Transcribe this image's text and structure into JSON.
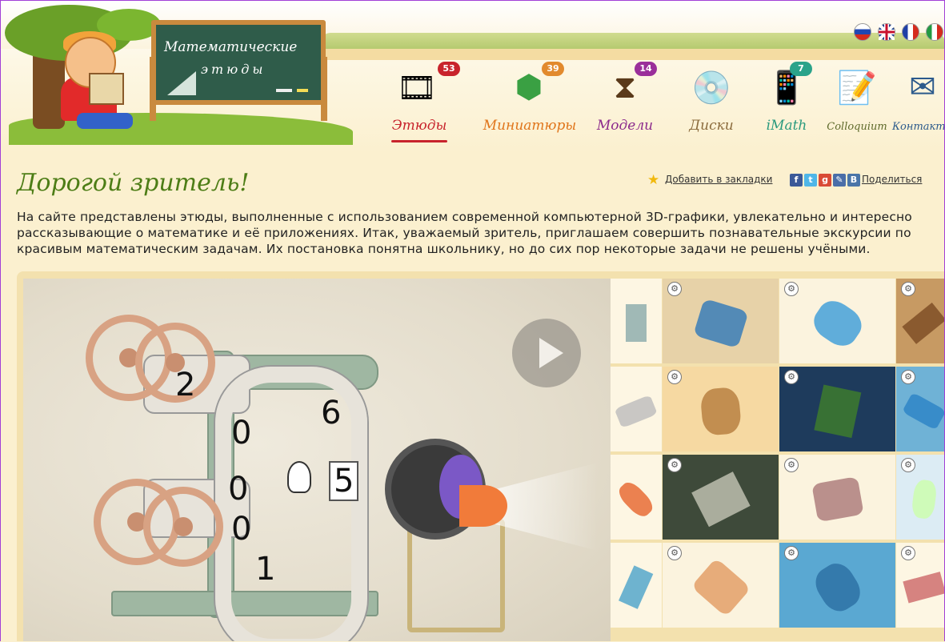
{
  "header": {
    "board_line1": "Математические",
    "board_line2": "этюды",
    "languages": [
      "ru",
      "en",
      "fr",
      "it"
    ],
    "nav": [
      {
        "label": "Этюды",
        "badge": "53",
        "label_color": "#c8232c",
        "badge_color": "#c8232c",
        "icon": "film-reel-icon",
        "glyph": "🎞"
      },
      {
        "label": "Миниатюры",
        "badge": "39",
        "label_color": "#e0751b",
        "badge_color": "#e28a2d",
        "icon": "polyhedron-icon",
        "glyph": "⬢"
      },
      {
        "label": "Модели",
        "badge": "14",
        "label_color": "#8c2a8c",
        "badge_color": "#9a2f9a",
        "icon": "model-icon",
        "glyph": "⧗"
      },
      {
        "label": "Диски",
        "badge": "",
        "label_color": "#8b6b3c",
        "badge_color": "",
        "icon": "disc-icon",
        "glyph": "💿"
      },
      {
        "label": "iMath",
        "badge": "7",
        "label_color": "#2a9a7e",
        "badge_color": "#2aa38a",
        "icon": "phone-icon",
        "glyph": "📱"
      },
      {
        "label": "Colloquium",
        "badge": "",
        "label_color": "#5f6a2b",
        "badge_color": "",
        "icon": "notes-icon",
        "glyph": "📝"
      },
      {
        "label": "Контакты",
        "badge": "",
        "label_color": "#2c5a8c",
        "badge_color": "",
        "icon": "mail-icon",
        "glyph": "✉"
      }
    ]
  },
  "main": {
    "title": "Дорогой зритель!",
    "bookmark_label": "Добавить в закладки",
    "share_label": "Поделиться",
    "description": "На сайте представлены этюды, выполненные с использованием современной компьютерной 3D-графики, увлекательно и интересно рассказывающие о математике и её приложениях. Итак, уважаемый зритель, приглашаем совершить познавательные экскурсии по красивым математическим задачам. Их постановка понятна школьнику, но до сих пор некоторые задачи не решены учёными.",
    "video": {
      "digits": [
        "2",
        "0",
        "6",
        "5",
        "0",
        "0",
        "1"
      ]
    },
    "thumbnails": [
      {
        "bg": "#fdf6e3",
        "accent": "#8aa"
      },
      {
        "bg": "#e7d2a8",
        "accent": "#2e78b9"
      },
      {
        "bg": "#fbf3de",
        "accent": "#3a9bd8"
      },
      {
        "bg": "#c79a63",
        "accent": "#7a4a22"
      },
      {
        "bg": "#fdf6e3",
        "accent": "#bbb"
      },
      {
        "bg": "#f6d9a2",
        "accent": "#b57a3c"
      },
      {
        "bg": "#1e3b5c",
        "accent": "#3f7f2a"
      },
      {
        "bg": "#6fb2d6",
        "accent": "#2a82c6"
      },
      {
        "bg": "#fdf6e3",
        "accent": "#e6642b"
      },
      {
        "bg": "#3e4a3a",
        "accent": "#c6c6b6"
      },
      {
        "bg": "#fbf3de",
        "accent": "#a77"
      },
      {
        "bg": "#dcecf4",
        "accent": "#cfa"
      },
      {
        "bg": "#fdf6e3",
        "accent": "#4aa3c9"
      },
      {
        "bg": "#fbf3de",
        "accent": "#e29a60"
      },
      {
        "bg": "#5aa8d2",
        "accent": "#2b6ea3"
      },
      {
        "bg": "#fdf6e3",
        "accent": "#c66"
      }
    ]
  }
}
